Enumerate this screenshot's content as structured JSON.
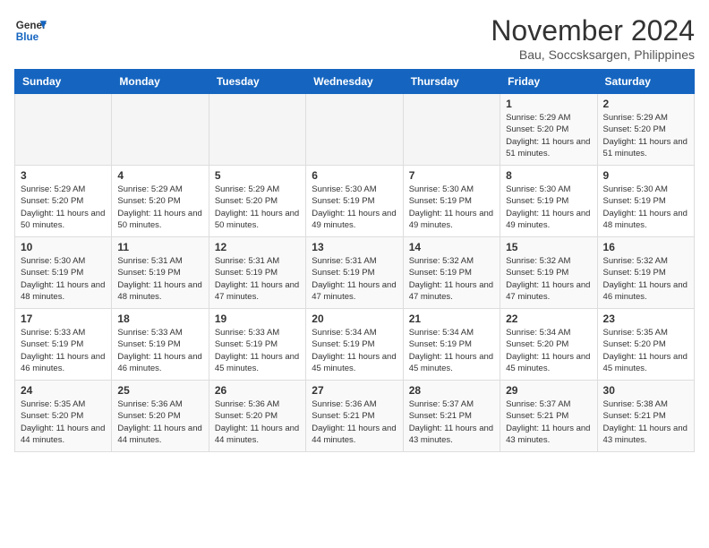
{
  "header": {
    "logo_line1": "General",
    "logo_line2": "Blue",
    "month": "November 2024",
    "location": "Bau, Soccsksargen, Philippines"
  },
  "weekdays": [
    "Sunday",
    "Monday",
    "Tuesday",
    "Wednesday",
    "Thursday",
    "Friday",
    "Saturday"
  ],
  "weeks": [
    [
      {
        "day": "",
        "info": ""
      },
      {
        "day": "",
        "info": ""
      },
      {
        "day": "",
        "info": ""
      },
      {
        "day": "",
        "info": ""
      },
      {
        "day": "",
        "info": ""
      },
      {
        "day": "1",
        "info": "Sunrise: 5:29 AM\nSunset: 5:20 PM\nDaylight: 11 hours and 51 minutes."
      },
      {
        "day": "2",
        "info": "Sunrise: 5:29 AM\nSunset: 5:20 PM\nDaylight: 11 hours and 51 minutes."
      }
    ],
    [
      {
        "day": "3",
        "info": "Sunrise: 5:29 AM\nSunset: 5:20 PM\nDaylight: 11 hours and 50 minutes."
      },
      {
        "day": "4",
        "info": "Sunrise: 5:29 AM\nSunset: 5:20 PM\nDaylight: 11 hours and 50 minutes."
      },
      {
        "day": "5",
        "info": "Sunrise: 5:29 AM\nSunset: 5:20 PM\nDaylight: 11 hours and 50 minutes."
      },
      {
        "day": "6",
        "info": "Sunrise: 5:30 AM\nSunset: 5:19 PM\nDaylight: 11 hours and 49 minutes."
      },
      {
        "day": "7",
        "info": "Sunrise: 5:30 AM\nSunset: 5:19 PM\nDaylight: 11 hours and 49 minutes."
      },
      {
        "day": "8",
        "info": "Sunrise: 5:30 AM\nSunset: 5:19 PM\nDaylight: 11 hours and 49 minutes."
      },
      {
        "day": "9",
        "info": "Sunrise: 5:30 AM\nSunset: 5:19 PM\nDaylight: 11 hours and 48 minutes."
      }
    ],
    [
      {
        "day": "10",
        "info": "Sunrise: 5:30 AM\nSunset: 5:19 PM\nDaylight: 11 hours and 48 minutes."
      },
      {
        "day": "11",
        "info": "Sunrise: 5:31 AM\nSunset: 5:19 PM\nDaylight: 11 hours and 48 minutes."
      },
      {
        "day": "12",
        "info": "Sunrise: 5:31 AM\nSunset: 5:19 PM\nDaylight: 11 hours and 47 minutes."
      },
      {
        "day": "13",
        "info": "Sunrise: 5:31 AM\nSunset: 5:19 PM\nDaylight: 11 hours and 47 minutes."
      },
      {
        "day": "14",
        "info": "Sunrise: 5:32 AM\nSunset: 5:19 PM\nDaylight: 11 hours and 47 minutes."
      },
      {
        "day": "15",
        "info": "Sunrise: 5:32 AM\nSunset: 5:19 PM\nDaylight: 11 hours and 47 minutes."
      },
      {
        "day": "16",
        "info": "Sunrise: 5:32 AM\nSunset: 5:19 PM\nDaylight: 11 hours and 46 minutes."
      }
    ],
    [
      {
        "day": "17",
        "info": "Sunrise: 5:33 AM\nSunset: 5:19 PM\nDaylight: 11 hours and 46 minutes."
      },
      {
        "day": "18",
        "info": "Sunrise: 5:33 AM\nSunset: 5:19 PM\nDaylight: 11 hours and 46 minutes."
      },
      {
        "day": "19",
        "info": "Sunrise: 5:33 AM\nSunset: 5:19 PM\nDaylight: 11 hours and 45 minutes."
      },
      {
        "day": "20",
        "info": "Sunrise: 5:34 AM\nSunset: 5:19 PM\nDaylight: 11 hours and 45 minutes."
      },
      {
        "day": "21",
        "info": "Sunrise: 5:34 AM\nSunset: 5:19 PM\nDaylight: 11 hours and 45 minutes."
      },
      {
        "day": "22",
        "info": "Sunrise: 5:34 AM\nSunset: 5:20 PM\nDaylight: 11 hours and 45 minutes."
      },
      {
        "day": "23",
        "info": "Sunrise: 5:35 AM\nSunset: 5:20 PM\nDaylight: 11 hours and 45 minutes."
      }
    ],
    [
      {
        "day": "24",
        "info": "Sunrise: 5:35 AM\nSunset: 5:20 PM\nDaylight: 11 hours and 44 minutes."
      },
      {
        "day": "25",
        "info": "Sunrise: 5:36 AM\nSunset: 5:20 PM\nDaylight: 11 hours and 44 minutes."
      },
      {
        "day": "26",
        "info": "Sunrise: 5:36 AM\nSunset: 5:20 PM\nDaylight: 11 hours and 44 minutes."
      },
      {
        "day": "27",
        "info": "Sunrise: 5:36 AM\nSunset: 5:21 PM\nDaylight: 11 hours and 44 minutes."
      },
      {
        "day": "28",
        "info": "Sunrise: 5:37 AM\nSunset: 5:21 PM\nDaylight: 11 hours and 43 minutes."
      },
      {
        "day": "29",
        "info": "Sunrise: 5:37 AM\nSunset: 5:21 PM\nDaylight: 11 hours and 43 minutes."
      },
      {
        "day": "30",
        "info": "Sunrise: 5:38 AM\nSunset: 5:21 PM\nDaylight: 11 hours and 43 minutes."
      }
    ]
  ]
}
